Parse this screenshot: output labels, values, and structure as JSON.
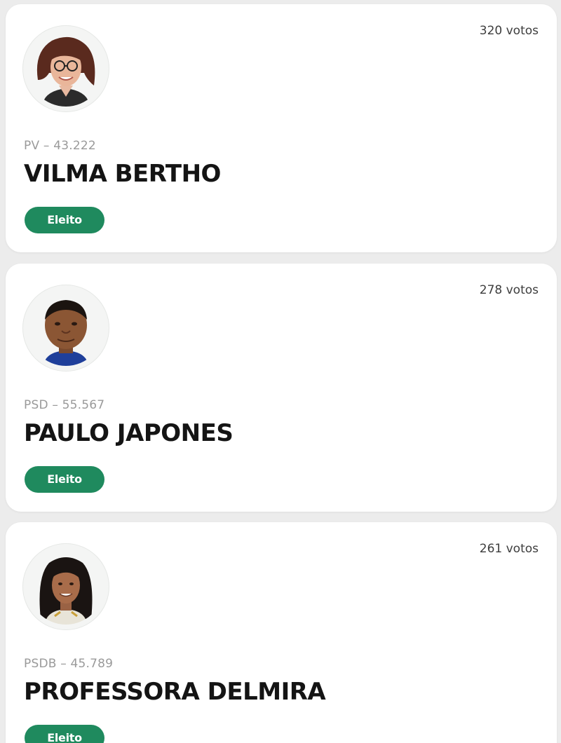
{
  "candidates": [
    {
      "votes": "320 votos",
      "party": "PV – 43.222",
      "name": "VILMA BERTHO",
      "status": "Eleito"
    },
    {
      "votes": "278 votos",
      "party": "PSD – 55.567",
      "name": "PAULO JAPONES",
      "status": "Eleito"
    },
    {
      "votes": "261 votos",
      "party": "PSDB – 45.789",
      "name": "PROFESSORA DELMIRA",
      "status": "Eleito"
    }
  ],
  "colors": {
    "badge": "#1f8a5e",
    "background": "#ececec",
    "card": "#ffffff"
  }
}
